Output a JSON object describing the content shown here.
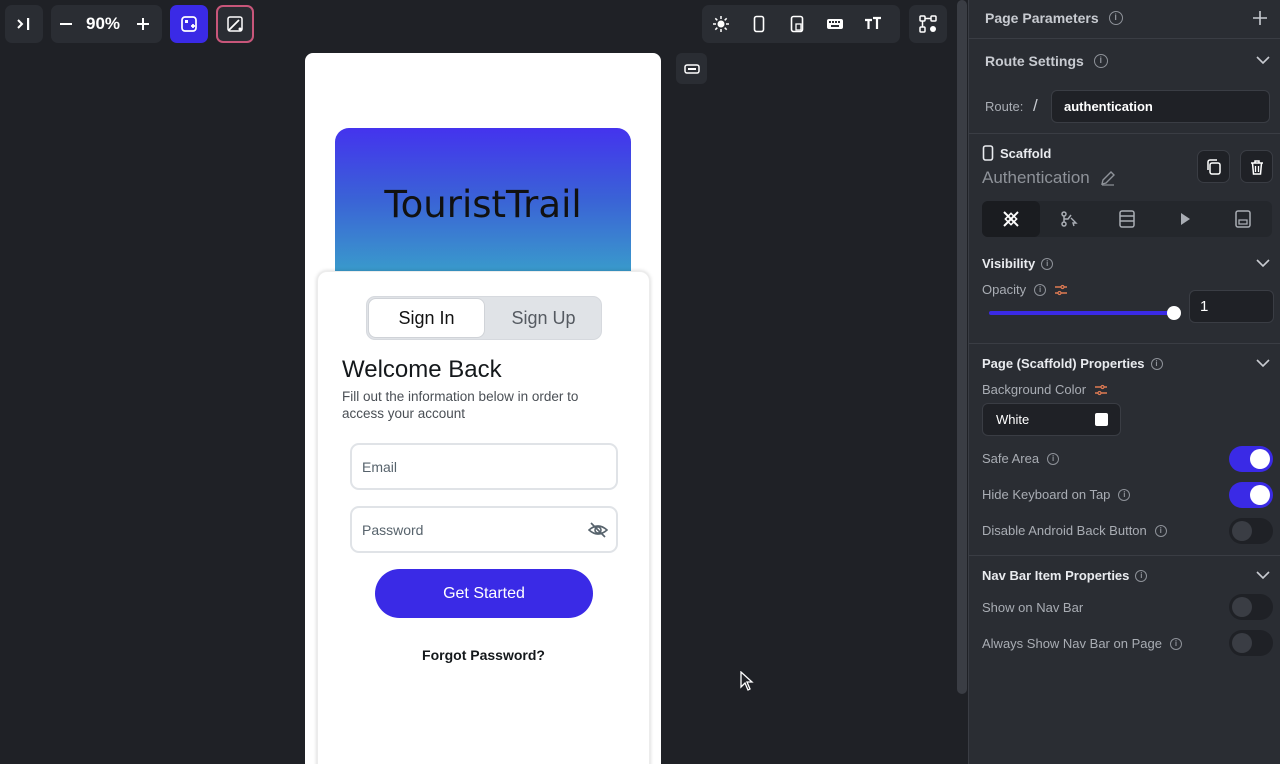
{
  "toolbar": {
    "zoom_value": "90%",
    "icons": [
      "collapse-panel-icon",
      "zoom-out-icon",
      "zoom-in-icon",
      "add-widget-icon",
      "magic-edit-icon",
      "theme-icon",
      "phone-device-icon",
      "tablet-device-icon",
      "keyboard-icon",
      "text-scale-icon",
      "canvas-settings-icon"
    ]
  },
  "phone": {
    "hero_title": "TouristTrail",
    "tabs": [
      "Sign In",
      "Sign Up"
    ],
    "active_tab": "Sign In",
    "welcome_title": "Welcome Back",
    "welcome_subtitle": "Fill out the information below in order to access your account",
    "email_placeholder": "Email",
    "password_placeholder": "Password",
    "submit_label": "Get Started",
    "forgot_label": "Forgot Password?",
    "hero_gradient": [
      "#4433ee",
      "#39a7c9"
    ],
    "button_color": "#3a2ae6"
  },
  "panel": {
    "page_parameters": "Page Parameters",
    "route_settings": "Route Settings",
    "route_label": "Route:",
    "route_slash": "/",
    "route_value": "authentication",
    "scaffold_label": "Scaffold",
    "page_name": "Authentication",
    "visibility": {
      "title": "Visibility",
      "opacity_label": "Opacity",
      "opacity_value": "1",
      "opacity_fraction": 1.0
    },
    "page_props": {
      "title": "Page (Scaffold) Properties",
      "bg_color_label": "Background Color",
      "bg_color_value": "White",
      "toggles": [
        {
          "label": "Safe Area",
          "on": true
        },
        {
          "label": "Hide Keyboard on Tap",
          "on": true
        },
        {
          "label": "Disable Android Back Button",
          "on": false
        }
      ]
    },
    "nav_props": {
      "title": "Nav Bar Item Properties",
      "toggles": [
        {
          "label": "Show on Nav Bar",
          "on": false
        },
        {
          "label": "Always Show Nav Bar on Page",
          "on": false
        }
      ]
    },
    "accent_color": "#3a2ae6"
  }
}
